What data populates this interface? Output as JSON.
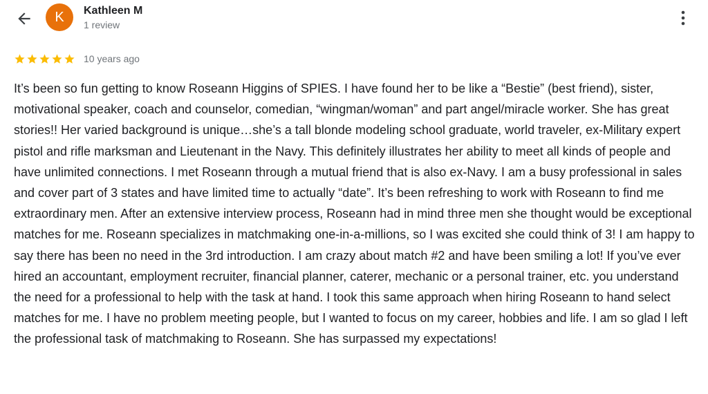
{
  "icons": {
    "back": "arrow-left-icon",
    "more": "more-vertical-icon",
    "star": "star-icon"
  },
  "colors": {
    "avatar_bg": "#e8710a",
    "star": "#fbbc04",
    "secondary_text": "#70757a",
    "primary_text": "#202124"
  },
  "reviewer": {
    "initial": "K",
    "name": "Kathleen M",
    "review_count": "1 review"
  },
  "review": {
    "rating": 5,
    "max_rating": 5,
    "timestamp": "10 years ago",
    "text": "It’s been so fun getting to know Roseann Higgins of SPIES. I have found her to be like a “Bestie” (best friend), sister, motivational speaker, coach and counselor, comedian, “wingman/woman” and part angel/miracle worker. She has great stories!! Her varied background is unique…she’s a tall blonde modeling school graduate, world traveler, ex-Military expert pistol and rifle marksman and Lieutenant in the Navy. This definitely illustrates her ability to meet all kinds of people and have unlimited connections. I met Roseann through a mutual friend that is also ex-Navy. I am a busy professional in sales and cover part of 3 states and have limited time to actually “date”. It’s been refreshing to work with Roseann to find me extraordinary men. After an extensive interview process, Roseann had in mind three men she thought would be exceptional matches for me. Roseann specializes in matchmaking one-in-a-millions, so I was excited she could think of 3! I am happy to say there has been no need in the 3rd introduction. I am crazy about match #2 and have been smiling a lot! If you’ve ever hired an accountant, employment recruiter, financial planner, caterer, mechanic or a personal trainer, etc. you understand the need for a professional to help with the task at hand. I took this same approach when hiring Roseann to hand select matches for me. I have no problem meeting people, but I wanted to focus on my career, hobbies and life. I am so glad I left the professional task of matchmaking to Roseann. She has surpassed my expectations!"
  }
}
